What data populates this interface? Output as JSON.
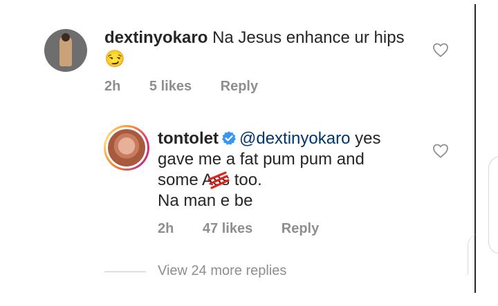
{
  "comment1": {
    "username": "dextinyokaro",
    "text": "Na Jesus enhance ur hips",
    "emoji": "😏",
    "time": "2h",
    "likes": "5 likes",
    "reply_label": "Reply",
    "avatar_icon": "profile-photo",
    "like_icon": "heart-outline"
  },
  "reply1": {
    "username": "tontolet",
    "verified_icon": "verified-badge",
    "mention": "@dextinyokaro",
    "line1_rest": "yes",
    "line2": "gave me a fat pum pum and",
    "line3_prefix": "some A",
    "line3_scribbled": "ss",
    "line3_suffix": " too.",
    "line4": "Na man e be",
    "time": "2h",
    "likes": "47 likes",
    "reply_label": "Reply",
    "like_icon": "heart-outline"
  },
  "view_more": "View 24 more replies",
  "colors": {
    "text": "#262626",
    "muted": "#8e8e8e",
    "mention": "#00376b",
    "verified": "#3897f0",
    "scribble": "#e0241b"
  }
}
